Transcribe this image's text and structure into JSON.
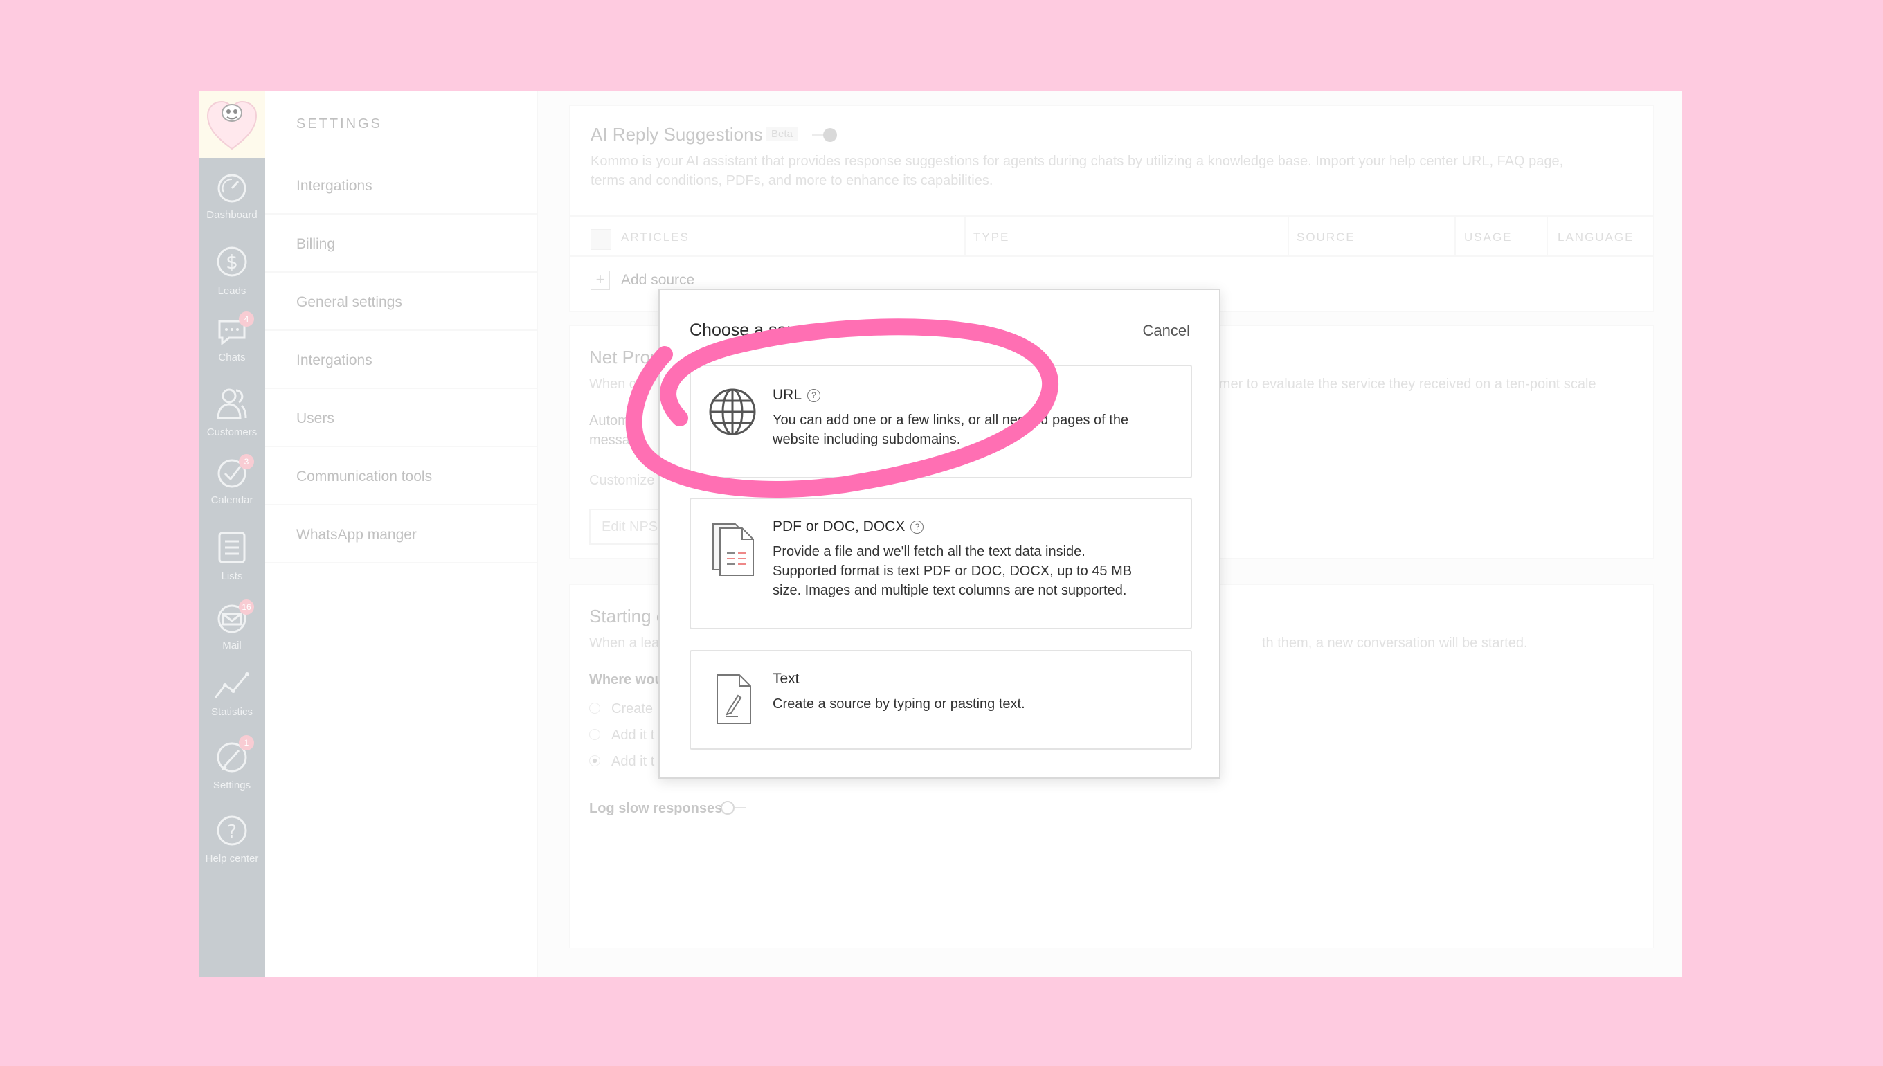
{
  "rail": {
    "items": [
      {
        "label": "Dashboard",
        "badge": ""
      },
      {
        "label": "Leads",
        "badge": ""
      },
      {
        "label": "Chats",
        "badge": "4"
      },
      {
        "label": "Customers",
        "badge": ""
      },
      {
        "label": "Calendar",
        "badge": "3"
      },
      {
        "label": "Lists",
        "badge": ""
      },
      {
        "label": "Mail",
        "badge": "16"
      },
      {
        "label": "Statistics",
        "badge": ""
      },
      {
        "label": "Settings",
        "badge": "1"
      },
      {
        "label": "Help center",
        "badge": ""
      }
    ]
  },
  "settings": {
    "title": "SETTINGS",
    "items": [
      "Intergations",
      "Billing",
      "General settings",
      "Intergations",
      "Users",
      "Communication tools",
      "WhatsApp manger"
    ]
  },
  "ai": {
    "title": "AI Reply Suggestions",
    "badge": "Beta",
    "description_1": "Kommo is your AI assistant that provides response suggestions for agents during chats by utilizing a knowledge base. Import your help center URL, FAQ page,",
    "description_2": "terms and conditions, PDFs, and more to enhance its capabilities.",
    "columns": [
      "ARTICLES",
      "TYPE",
      "SOURCE",
      "USAGE",
      "LANGUAGE"
    ],
    "add_source": "Add source"
  },
  "nps": {
    "title": "Net Prom",
    "desc_left": "When c",
    "desc_right": "ustomer to evaluate the service they received on a ten-point scale",
    "auto_1": "Autom",
    "auto_2": "messag",
    "customize": "Customize",
    "edit_placeholder": "Edit NPS"
  },
  "starting": {
    "title": "Starting c",
    "desc_left": "When a lea",
    "desc_right": "th them, a new conversation will be started.",
    "where": "Where wou",
    "options": [
      "Create",
      "Add it t",
      "Add it t"
    ],
    "log_slow": "Log slow responses"
  },
  "modal": {
    "title": "Choose a source",
    "cancel": "Cancel",
    "options": [
      {
        "title": "URL",
        "icon": "globe-icon",
        "desc_1": "You can add one or a few links, or all needed pages of the",
        "desc_2": "website including subdomains."
      },
      {
        "title": "PDF or DOC, DOCX",
        "icon": "document-icon",
        "desc_1": "Provide a file and we'll fetch all the text data inside.",
        "desc_2": "Supported format is text PDF or DOC, DOCX, up to 45 MB",
        "desc_3": "size. Images and multiple text columns are not supported."
      },
      {
        "title": "Text",
        "icon": "pencil-document-icon",
        "desc_1": "Create a source by typing or pasting text."
      }
    ]
  },
  "colors": {
    "page_bg": "#fecbe0",
    "highlight": "#ff6fb3",
    "rail": "#9aa2a9"
  }
}
